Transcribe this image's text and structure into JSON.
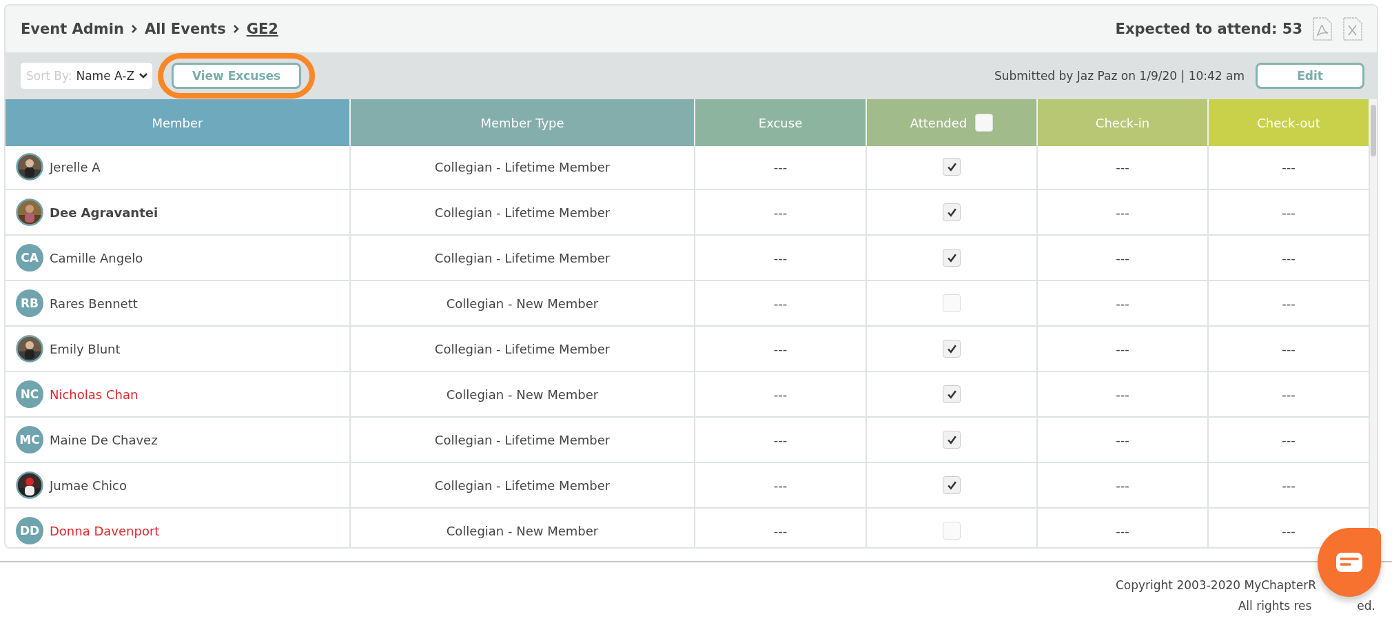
{
  "breadcrumb": [
    {
      "label": "Event Admin",
      "current": false
    },
    {
      "label": "All Events",
      "current": false
    },
    {
      "label": " GE2",
      "current": true
    }
  ],
  "expected": "Expected to attend: 53",
  "toolbar": {
    "sort_label": "Sort By:",
    "sort_value": "Name A-Z",
    "view_button": "View Excuses",
    "submitted": "Submitted by Jaz Paz on 1/9/20 | 10:42 am",
    "edit_button": "Edit"
  },
  "table": {
    "columns": [
      {
        "label": "Member",
        "color": "#6ea9bd"
      },
      {
        "label": "Member Type",
        "color": "#83aeac"
      },
      {
        "label": "Excuse",
        "color": "#8db49e"
      },
      {
        "label": "Attended",
        "color": "#a1bc8a",
        "kind": "checkbox",
        "checked": false
      },
      {
        "label": "Check-in",
        "color": "#b7c774"
      },
      {
        "label": "Check-out",
        "color": "#c9d14a"
      }
    ],
    "rows": [
      {
        "name": "Jerelle A",
        "bold": false,
        "flagged": false,
        "type": "Collegian - Lifetime Member",
        "excuse": "---",
        "attended": true,
        "check_in": "---",
        "check_out": "---"
      },
      {
        "name": "Dee Agravantei",
        "bold": true,
        "flagged": false,
        "type": "Collegian - Lifetime Member",
        "excuse": "---",
        "attended": true,
        "check_in": "---",
        "check_out": "---"
      },
      {
        "avatar": {
          "kind": "initials",
          "initials": "CA"
        },
        "name": "Camille Angelo",
        "bold": false,
        "flagged": false,
        "type": "Collegian - Lifetime Member",
        "excuse": "---",
        "attended": true,
        "check_in": "---",
        "check_out": "---"
      },
      {
        "avatar": {
          "kind": "initials",
          "initials": "RB"
        },
        "name": "Rares Bennett",
        "bold": false,
        "flagged": false,
        "type": "Collegian - New Member",
        "excuse": "---",
        "attended": false,
        "check_in": "---",
        "check_out": "---"
      },
      {
        "name": "Emily Blunt",
        "bold": false,
        "flagged": false,
        "type": "Collegian - Lifetime Member",
        "excuse": "---",
        "attended": true,
        "check_in": "---",
        "check_out": "---"
      },
      {
        "avatar": {
          "kind": "initials",
          "initials": "NC"
        },
        "name": "Nicholas Chan",
        "bold": false,
        "flagged": true,
        "type": "Collegian - New Member",
        "excuse": "---",
        "attended": true,
        "check_in": "---",
        "check_out": "---"
      },
      {
        "avatar": {
          "kind": "initials",
          "initials": "MC"
        },
        "name": "Maine De Chavez",
        "bold": false,
        "flagged": false,
        "type": "Collegian - Lifetime Member",
        "excuse": "---",
        "attended": true,
        "check_in": "---",
        "check_out": "---"
      },
      {
        "name": "Jumae Chico",
        "bold": false,
        "flagged": false,
        "type": "Collegian - Lifetime Member",
        "excuse": "---",
        "attended": true,
        "check_in": "---",
        "check_out": "---"
      },
      {
        "avatar": {
          "kind": "initials",
          "initials": "DD"
        },
        "name": "Donna Davenport",
        "bold": false,
        "flagged": true,
        "type": "Collegian - New Member",
        "excuse": "---",
        "attended": false,
        "check_in": "---",
        "check_out": "---"
      }
    ]
  },
  "footer": {
    "line_1": "Copyright 2003-2020 MyChapterR",
    "line_2_start": "All rights res",
    "line_2_end": "ed."
  }
}
